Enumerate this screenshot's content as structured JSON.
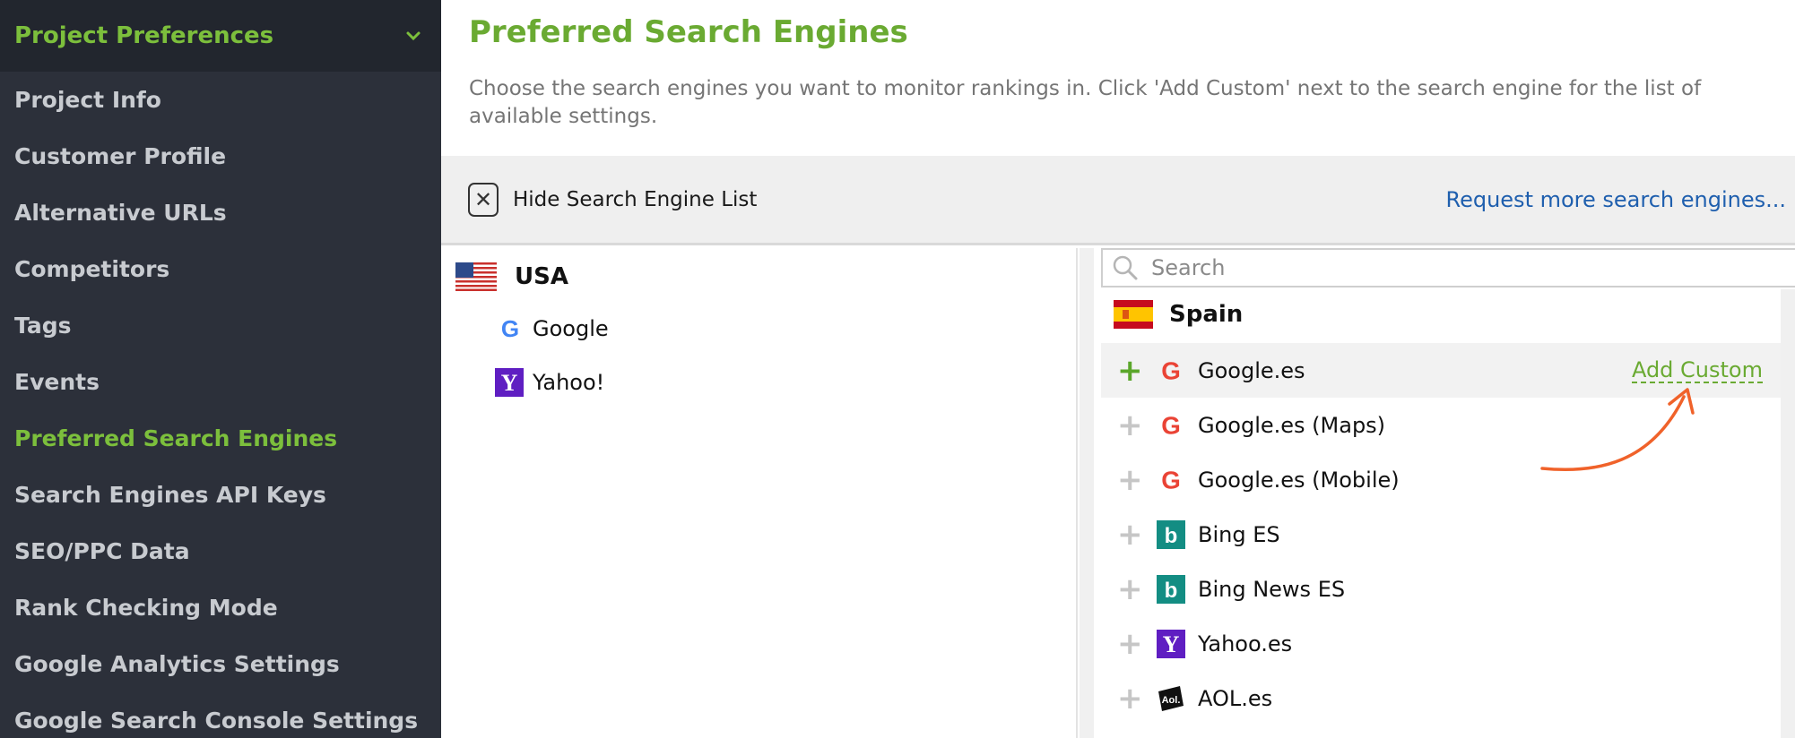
{
  "sidebar": {
    "header_title": "Project Preferences",
    "items": [
      {
        "label": "Project Info"
      },
      {
        "label": "Customer Profile"
      },
      {
        "label": "Alternative URLs"
      },
      {
        "label": "Competitors"
      },
      {
        "label": "Tags"
      },
      {
        "label": "Events"
      },
      {
        "label": "Preferred Search Engines"
      },
      {
        "label": "Search Engines API Keys"
      },
      {
        "label": "SEO/PPC Data"
      },
      {
        "label": "Rank Checking Mode"
      },
      {
        "label": "Google Analytics Settings"
      },
      {
        "label": "Google Search Console Settings"
      }
    ],
    "active_item": "Preferred Search Engines"
  },
  "main": {
    "title": "Preferred Search Engines",
    "description": "Choose the search engines you want to monitor rankings in. Click 'Add Custom' next to the search engine for the list of available settings.",
    "toolbar": {
      "hide_label": "Hide Search Engine List",
      "request_link": "Request more search engines..."
    },
    "selected": {
      "country": "USA",
      "engines": [
        {
          "name": "Google",
          "icon": "google-icon"
        },
        {
          "name": "Yahoo!",
          "icon": "yahoo-icon"
        }
      ]
    },
    "available": {
      "search_placeholder": "Search",
      "country": "Spain",
      "add_custom_label": "Add Custom",
      "engines": [
        {
          "name": "Google.es",
          "icon": "google-icon",
          "added": true
        },
        {
          "name": "Google.es (Maps)",
          "icon": "google-icon",
          "added": false
        },
        {
          "name": "Google.es (Mobile)",
          "icon": "google-icon",
          "added": false
        },
        {
          "name": "Bing ES",
          "icon": "bing-icon",
          "added": false
        },
        {
          "name": "Bing News ES",
          "icon": "bing-icon",
          "added": false
        },
        {
          "name": "Yahoo.es",
          "icon": "yahoo-icon",
          "added": false
        },
        {
          "name": "AOL.es",
          "icon": "aol-icon",
          "added": false
        }
      ]
    }
  },
  "colors": {
    "sidebar_bg": "#2c303a",
    "accent_green": "#6aaa32",
    "link_blue": "#1f5fae",
    "arrow_orange": "#f0622a"
  }
}
